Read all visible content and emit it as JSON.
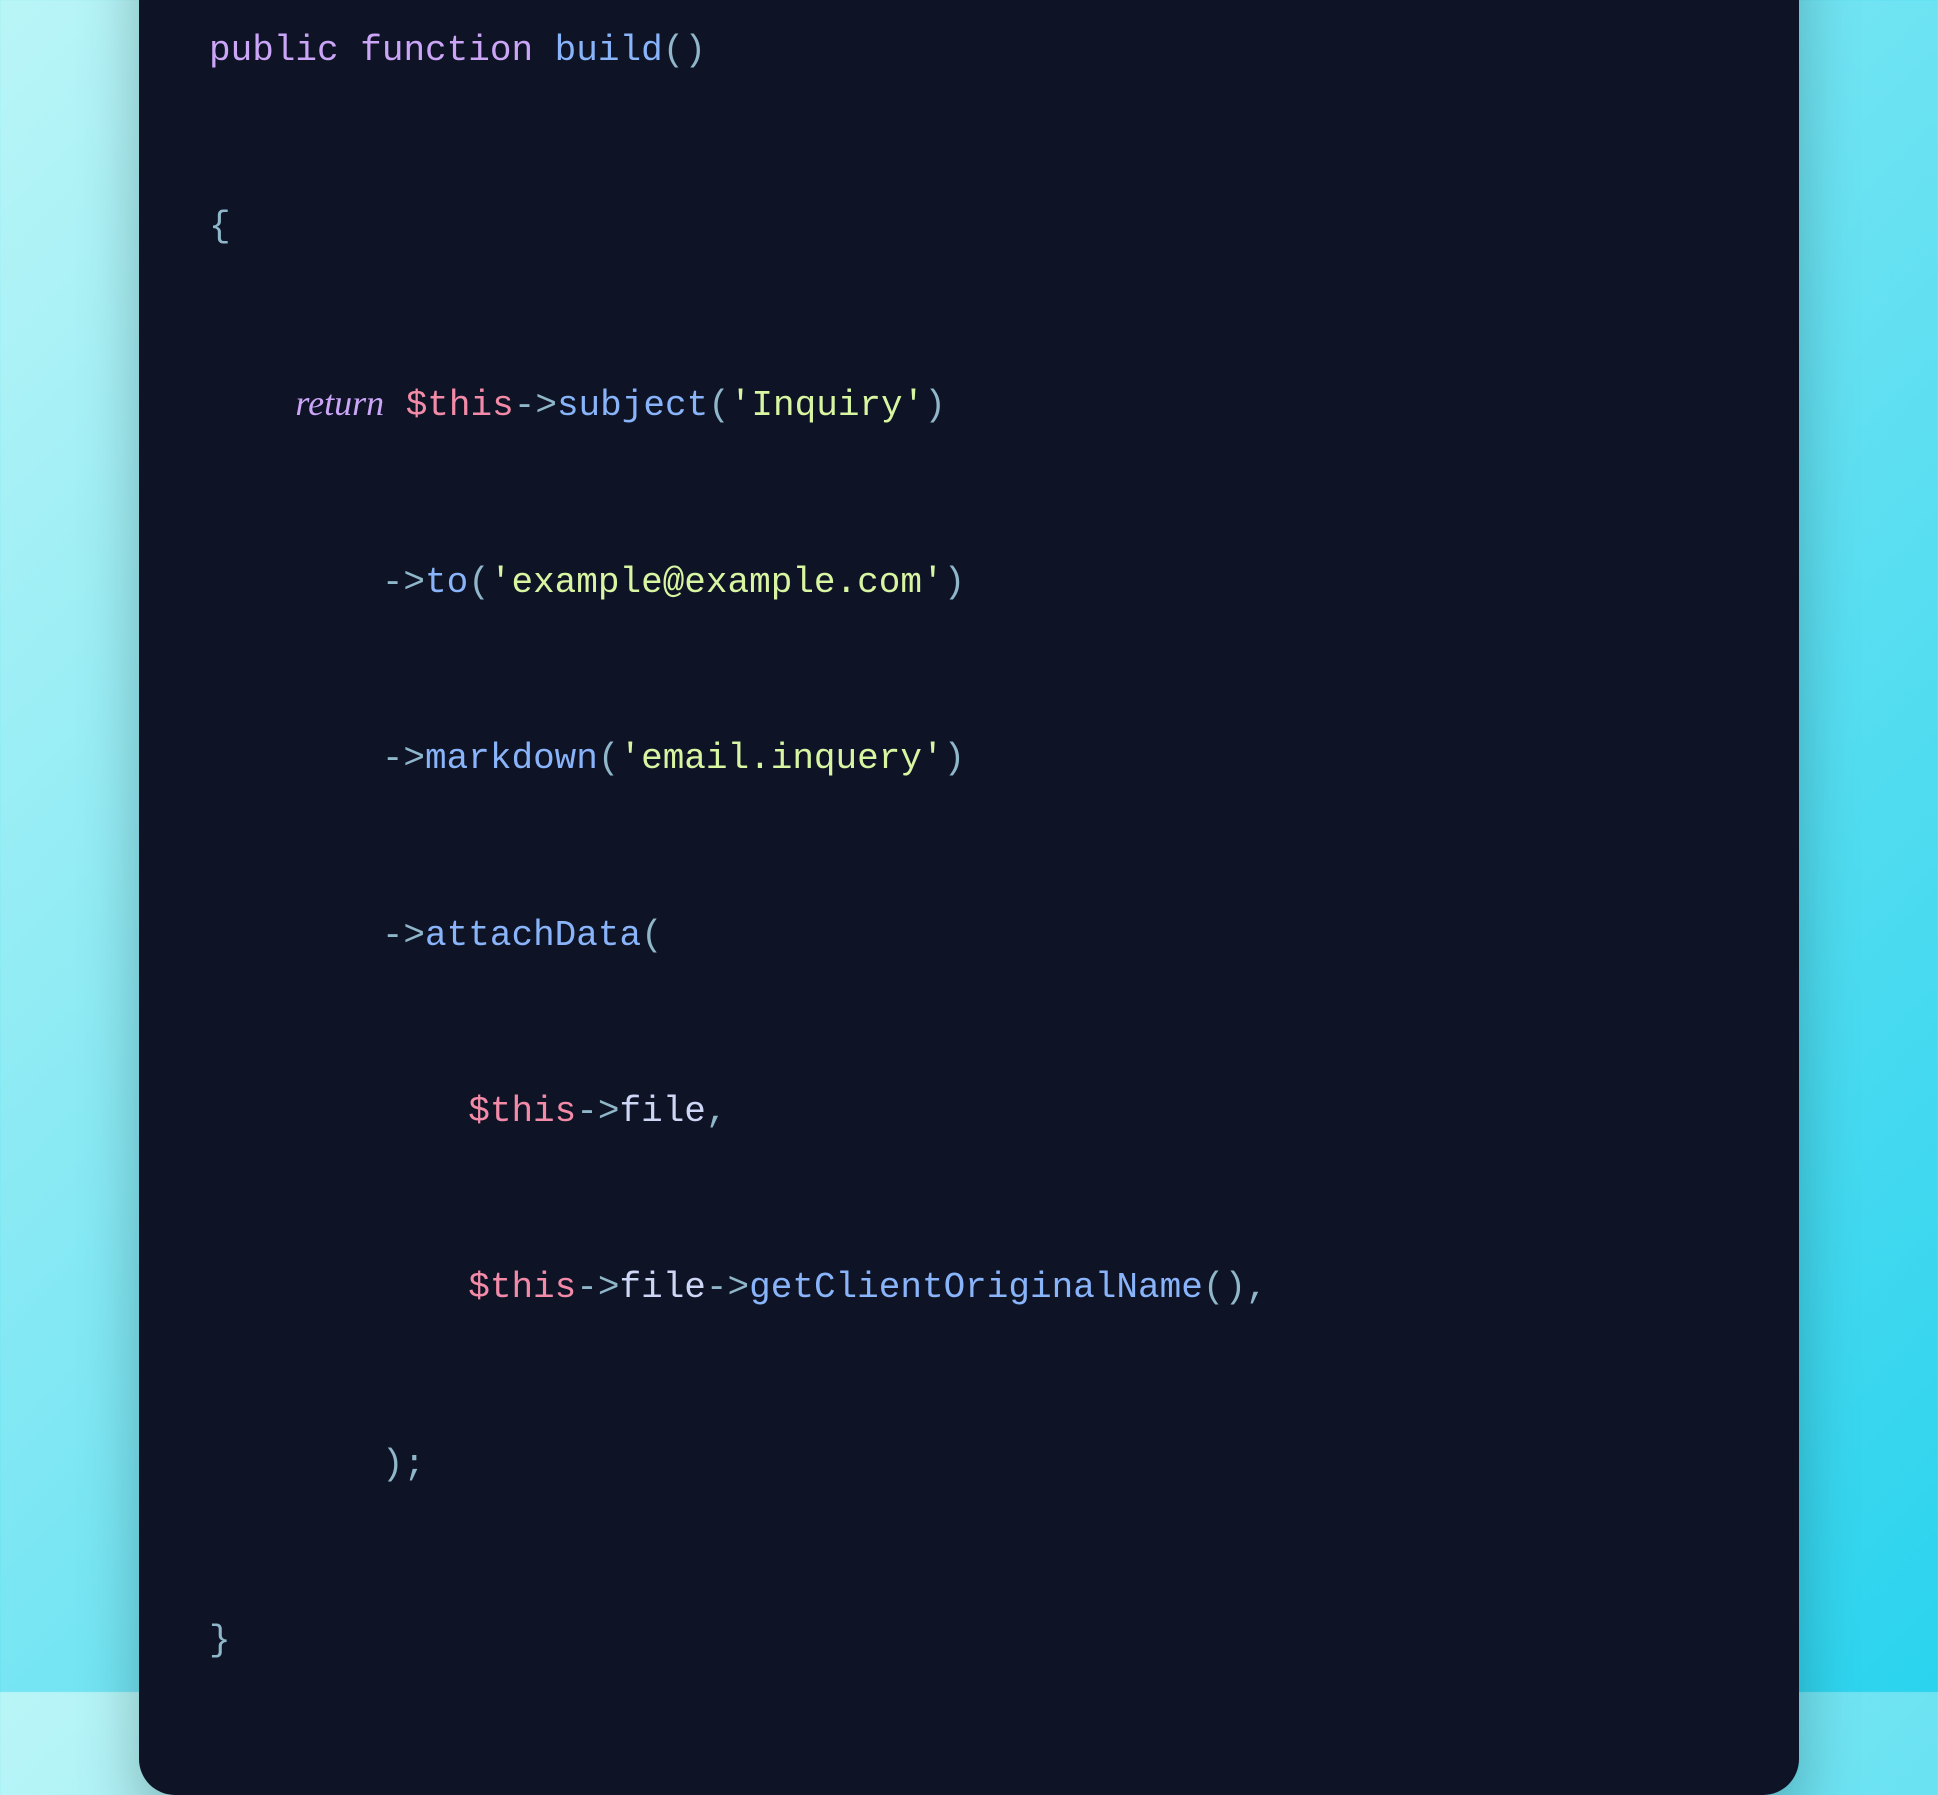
{
  "code": {
    "kw_public": "public",
    "kw_function": "function",
    "fn_build": "build",
    "paren_open": "(",
    "paren_close": ")",
    "brace_open": "{",
    "brace_close": "}",
    "kw_return": "return",
    "var_this": "$this",
    "arrow": "->",
    "m_subject": "subject",
    "str_inquiry": "'Inquiry'",
    "m_to": "to",
    "str_email": "'example@example.com'",
    "m_markdown": "markdown",
    "str_view": "'email.inquery'",
    "m_attachData": "attachData",
    "prop_file": "file",
    "comma": ",",
    "m_getClientOriginalName": "getClientOriginalName",
    "semicolon": ";"
  }
}
